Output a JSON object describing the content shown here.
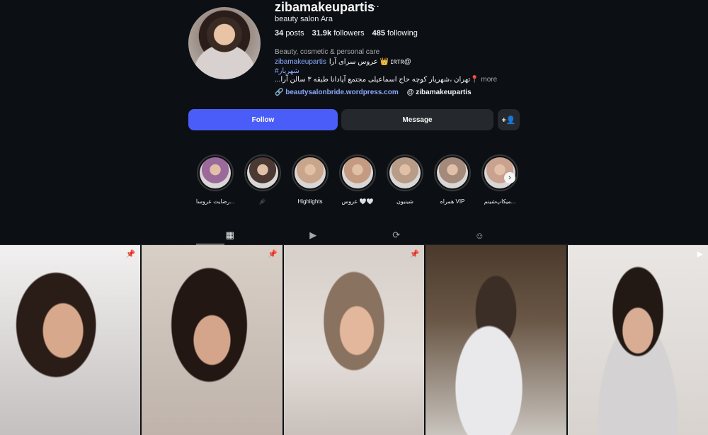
{
  "profile": {
    "username": "zibamakeupartis",
    "more": "···",
    "full_name": "beauty salon Ara",
    "stats": [
      {
        "value": "34",
        "label": "posts"
      },
      {
        "value": "31.9k",
        "label": "followers"
      },
      {
        "value": "485",
        "label": "following"
      }
    ],
    "category": "Beauty, cosmetic & personal care",
    "bio_line1_link": "zibamakeupartis",
    "bio_line1_rest": "عروس سرای آرا 👑 ɪʀᴛʀ@",
    "bio_line2": "#شهریار",
    "bio_line3": "...تهران ،شهریار کوچه حاج اسماعیلی مجتمع آپادانا طبقه ۳ سالن آرا📍",
    "bio_more": "more",
    "website": "beautysalonbride.wordpress.com",
    "threads": "zibamakeupartis"
  },
  "buttons": {
    "follow": "Follow",
    "message": "Message",
    "add_user": "+👤"
  },
  "highlights": [
    {
      "label": "رضایت عروسا...",
      "color": "#9b6a9a"
    },
    {
      "label": "🪮",
      "color": "#4a3a33"
    },
    {
      "label": "Highlights",
      "color": "#c9a58c"
    },
    {
      "label": "عروس 🤍🤍",
      "color": "#c49a80"
    },
    {
      "label": "شینیون",
      "color": "#b89c88"
    },
    {
      "label": "همراه VIP",
      "color": "#a48a7a"
    },
    {
      "label": "میکاپ‌شینم...",
      "color": "#c9a290"
    }
  ],
  "tabs": [
    {
      "name": "posts",
      "icon": "grid-icon",
      "glyph": "▦"
    },
    {
      "name": "reels",
      "icon": "reels-icon",
      "glyph": "▶"
    },
    {
      "name": "reposts",
      "icon": "repost-icon",
      "glyph": "⟳"
    },
    {
      "name": "tagged",
      "icon": "tagged-icon",
      "glyph": "☺"
    }
  ],
  "posts": [
    {
      "icon": "pin-icon",
      "glyph": "📌"
    },
    {
      "icon": "pin-icon",
      "glyph": "📌"
    },
    {
      "icon": "pin-icon",
      "glyph": "📌"
    },
    {
      "icon": "",
      "glyph": ""
    },
    {
      "icon": "reel-icon",
      "glyph": "▶"
    }
  ],
  "colors": {
    "background": "#0c1014",
    "accent": "#4a5df9",
    "link": "#8ca8ff"
  }
}
